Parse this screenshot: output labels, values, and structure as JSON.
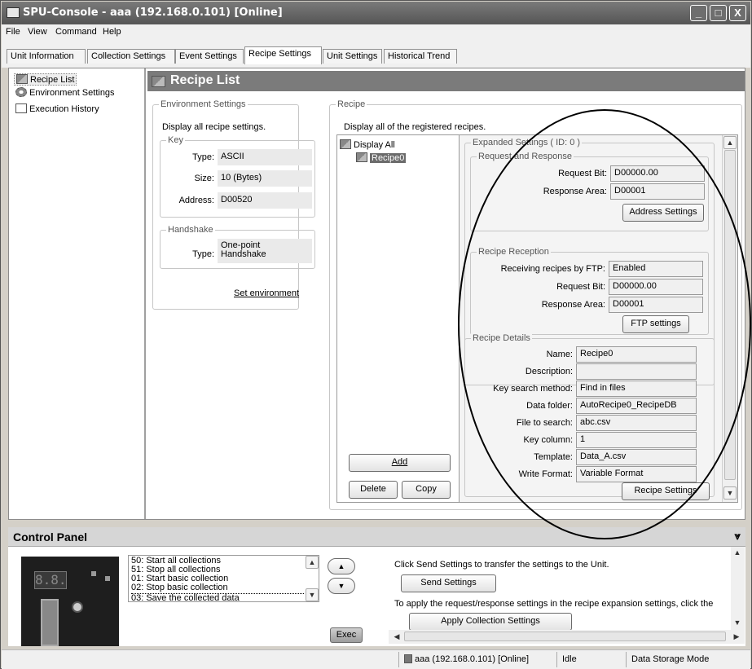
{
  "window": {
    "title": "SPU-Console - aaa (192.168.0.101) [Online]",
    "controls": [
      "_",
      "□",
      "X"
    ]
  },
  "menu": [
    "File",
    "View",
    "Command",
    "Help"
  ],
  "tabs": [
    "Unit Information",
    "Collection Settings",
    "Event Settings",
    "Recipe Settings",
    "Unit Settings",
    "Historical Trend"
  ],
  "active_tab": "Recipe Settings",
  "sidebar": {
    "items": [
      {
        "label": "Recipe List",
        "icon": "recipe-icon",
        "selected": true
      },
      {
        "label": "Environment Settings",
        "icon": "gear-icon"
      },
      {
        "label": "Execution History",
        "icon": "document-icon"
      }
    ]
  },
  "page_header": "Recipe List",
  "env": {
    "legend": "Environment Settings",
    "desc": "Display all recipe settings.",
    "key_legend": "Key",
    "type_label": "Type:",
    "type_value": "ASCII",
    "size_label": "Size:",
    "size_value": "10 (Bytes)",
    "address_label": "Address:",
    "address_value": "D00520",
    "handshake_legend": "Handshake",
    "hs_type_label": "Type:",
    "hs_type_value_1": "One-point",
    "hs_type_value_2": "Handshake",
    "set_env_link": "Set environment"
  },
  "recipe": {
    "legend": "Recipe",
    "desc": "Display all of the registered recipes.",
    "tree_root": "Display All",
    "tree_child": "Recipe0",
    "add_btn": "Add",
    "delete_btn": "Delete",
    "copy_btn": "Copy"
  },
  "expanded": {
    "legend": "Expanded Settings ( ID: 0 )",
    "rr_legend": "Request and Response",
    "request_bit_label": "Request Bit:",
    "request_bit_value": "D00000.00",
    "response_area_label": "Response Area:",
    "response_area_value": "D00001",
    "address_settings_btn": "Address Settings",
    "reception_legend": "Recipe Reception",
    "ftp_label": "Receiving recipes by FTP:",
    "ftp_value": "Enabled",
    "rec_request_bit_label": "Request Bit:",
    "rec_request_bit_value": "D00000.00",
    "rec_response_area_label": "Response Area:",
    "rec_response_area_value": "D00001",
    "ftp_settings_btn": "FTP settings"
  },
  "details": {
    "legend": "Recipe Details",
    "rows": [
      {
        "label": "Name:",
        "value": "Recipe0"
      },
      {
        "label": "Description:",
        "value": ""
      },
      {
        "label": "Key search method:",
        "value": "Find in files"
      },
      {
        "label": "Data folder:",
        "value": "AutoRecipe0_RecipeDB"
      },
      {
        "label": "File to search:",
        "value": "abc.csv"
      },
      {
        "label": "Key column:",
        "value": "1"
      },
      {
        "label": "Template:",
        "value": "Data_A.csv"
      },
      {
        "label": "Write Format:",
        "value": "Variable Format"
      }
    ],
    "recipe_settings_btn": "Recipe Settings"
  },
  "control_panel": {
    "title": "Control Panel",
    "commands": [
      "50: Start all collections",
      "51: Stop all collections",
      "01: Start basic collection",
      "02: Stop basic collection",
      "03: Save the collected data"
    ],
    "exec_btn": "Exec",
    "send_text": "Click Send Settings to transfer the settings to the Unit.",
    "send_btn": "Send Settings",
    "apply_text": "To apply the request/response settings in the recipe expansion settings, click the",
    "apply_btn": "Apply Collection Settings",
    "display_digits": "8.8."
  },
  "status": {
    "connection": "aaa (192.168.0.101) [Online]",
    "state": "Idle",
    "mode": "Data Storage Mode"
  }
}
